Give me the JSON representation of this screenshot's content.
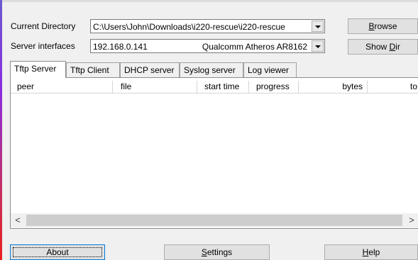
{
  "labels": {
    "current_directory": "Current Directory",
    "server_interfaces": "Server interfaces"
  },
  "current_directory": {
    "value": "C:\\Users\\John\\Downloads\\i220-rescue\\i220-rescue"
  },
  "server_interface": {
    "ip": "192.168.0.141",
    "adapter": "Qualcomm Atheros AR8162"
  },
  "buttons": {
    "browse_mnemonic": "B",
    "browse_rest": "rowse",
    "showdir_prefix": "Show ",
    "showdir_mnemonic": "D",
    "showdir_rest": "ir",
    "about": "About",
    "settings_mnemonic": "S",
    "settings_rest": "ettings",
    "help_mnemonic": "H",
    "help_rest": "elp"
  },
  "tabs": [
    {
      "label": "Tftp Server",
      "active": true
    },
    {
      "label": "Tftp Client",
      "active": false
    },
    {
      "label": "DHCP server",
      "active": false
    },
    {
      "label": "Syslog server",
      "active": false
    },
    {
      "label": "Log viewer",
      "active": false
    }
  ],
  "table": {
    "columns": [
      "peer",
      "file",
      "start time",
      "progress",
      "bytes",
      "to"
    ]
  },
  "scrollbar": {
    "left_arrow": "<",
    "right_arrow": ">"
  },
  "colors": {
    "window_bg": "#f0f0f0",
    "panel_bg": "#ffffff",
    "edge_gradient_top": "#6a5acd",
    "edge_gradient_bottom": "#e8201c"
  }
}
